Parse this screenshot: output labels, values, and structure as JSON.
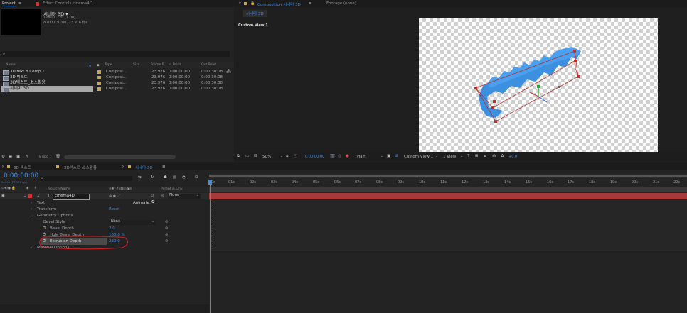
{
  "project_panel": {
    "tab_project": "Project",
    "tab_menu": "≡",
    "tab_effect_controls": "Effect Controls cinema4D",
    "comp_name": "시네마 3D ▾",
    "comp_info": "1280 x 720 (1.00)",
    "comp_duration": "Δ 0:00:30:08, 23.976 fps",
    "search_placeholder": "",
    "columns": [
      "Name",
      "Type",
      "Size",
      "Frame R...",
      "In Point",
      "Out Point"
    ],
    "items": [
      {
        "name": "3D text 8 Comp 1",
        "type": "Composi...",
        "fps": "23.976",
        "in": "0:00:00:00",
        "out": "0:00:30:08",
        "selected": false
      },
      {
        "name": "3D 텍스트",
        "type": "Composi...",
        "fps": "23.976",
        "in": "0:00:00:00",
        "out": "0:00:30:08",
        "selected": false
      },
      {
        "name": "3D텍스트_소스활용",
        "type": "Composi...",
        "fps": "23.976",
        "in": "0:00:00:00",
        "out": "0:00:30:08",
        "selected": false
      },
      {
        "name": "시네마 3D",
        "type": "Composi...",
        "fps": "23.976",
        "in": "0:00:00:00",
        "out": "0:00:30:08",
        "selected": true
      }
    ],
    "bpc": "8 bpc"
  },
  "composition_panel": {
    "tab_composition": "Composition 시네마 3D",
    "tab_menu": "≡",
    "tab_footage": "Footage (none)",
    "subtab": "시네마 3D",
    "view_label": "Custom View 1",
    "toolbar": {
      "zoom": "50%",
      "timecode": "0:00:00:00",
      "resolution": "(Half)",
      "view": "Custom View 1",
      "view_count": "1 View",
      "exposure": "+0.0"
    }
  },
  "timeline": {
    "tabs": [
      {
        "label": "3D 텍스트",
        "active": false
      },
      {
        "label": "3D텍스트_소스활용",
        "active": false
      },
      {
        "label": "시네마 3D",
        "active": true
      }
    ],
    "timecode": "0:00:00:00",
    "timecode_sub": "00000 (23.976 fps)",
    "col_source_name": "Source Name",
    "col_parent": "Parent & Link",
    "layer": {
      "number": "1",
      "type": "T",
      "name": "cinema4D",
      "parent": "None"
    },
    "animate_label": "Animate:",
    "properties": {
      "text": "Text",
      "transform": "Transform",
      "transform_value": "Reset",
      "geometry": "Geometry Options",
      "bevel_style": "Bevel Style",
      "bevel_style_value": "None",
      "bevel_depth": "Bevel Depth",
      "bevel_depth_value": "2.0",
      "hole_bevel_depth": "Hole Bevel Depth",
      "hole_bevel_depth_value": "100.0 %",
      "extrusion_depth": "Extrusion Depth",
      "extrusion_depth_value": "230.0",
      "material": "Material Options"
    },
    "ruler": [
      "0s",
      "01s",
      "02s",
      "03s",
      "04s",
      "05s",
      "06s",
      "07s",
      "08s",
      "09s",
      "10s",
      "11s",
      "12s",
      "13s",
      "14s",
      "15s",
      "16s",
      "17s",
      "18s",
      "19s",
      "20s",
      "21s",
      "22s"
    ]
  },
  "colors": {
    "accent_blue": "#3d8ee8",
    "layer_bar": "#a63a3a",
    "highlight_red": "#e01b24",
    "text_fill": "#3d90e0"
  }
}
